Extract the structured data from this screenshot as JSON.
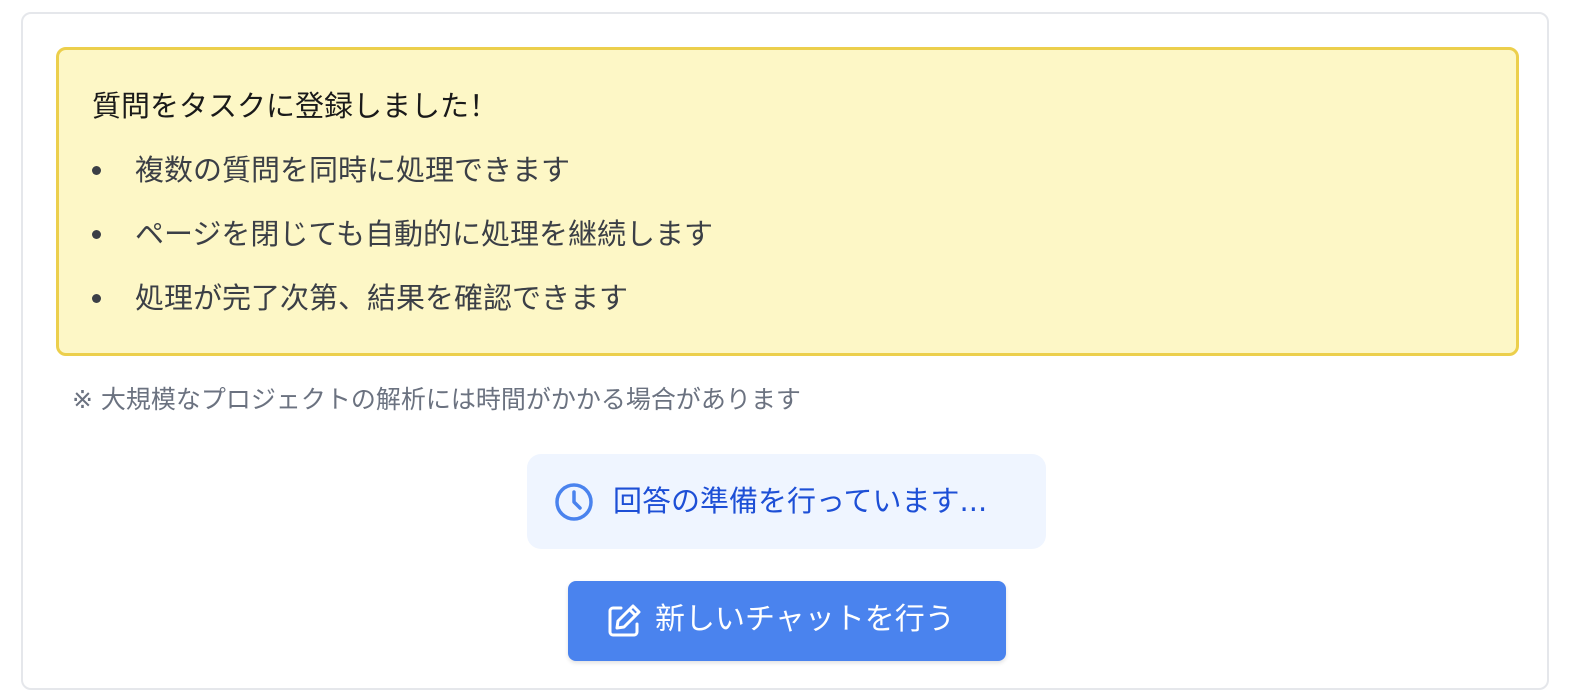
{
  "notice": {
    "title": "質問をタスクに登録しました！",
    "items": [
      {
        "label": "複数の質問を同時に処理できます"
      },
      {
        "label": "ページを閉じても自動的に処理を継続します"
      },
      {
        "label": "処理が完了次第、結果を確認できます"
      }
    ]
  },
  "footnote": "※ 大規模なプロジェクトの解析には時間がかかる場合があります",
  "status": {
    "icon": "clock-icon",
    "text": "回答の準備を行っています..."
  },
  "new_chat_button": {
    "icon": "edit-icon",
    "label": "新しいチャットを行う"
  },
  "colors": {
    "notice_background": "#fdf7c6",
    "notice_border": "#eccf4c",
    "status_background": "#eff5ff",
    "status_text": "#1d4fd6",
    "button_background": "#4a83ee",
    "footnote_text": "#6b7280"
  }
}
